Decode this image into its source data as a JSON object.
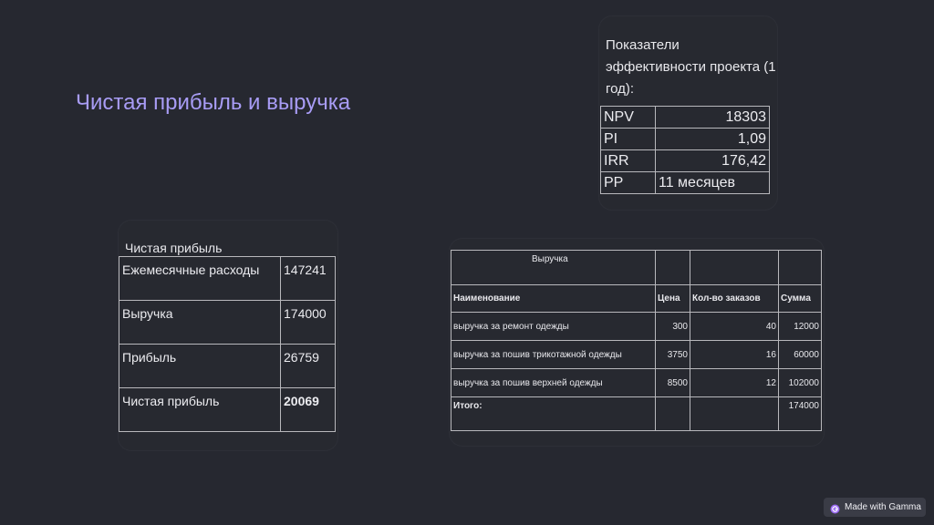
{
  "slide": {
    "title": "Чистая прибыль и выручка"
  },
  "kpi": {
    "heading": "Показатели эффективности проекта (1 год):",
    "rows": [
      {
        "name": "NPV",
        "value": "18303"
      },
      {
        "name": "PI",
        "value": "1,09"
      },
      {
        "name": "IRR",
        "value": "176,42"
      },
      {
        "name": "PP",
        "value": "11 месяцев"
      }
    ]
  },
  "profit": {
    "caption": "Чистая прибыль",
    "rows": [
      {
        "label": "Ежемесячные расходы",
        "value": "147241"
      },
      {
        "label": "Выручка",
        "value": "174000"
      },
      {
        "label": "Прибыль",
        "value": "26759"
      },
      {
        "label": "Чистая прибыль",
        "value": "20069"
      }
    ]
  },
  "revenue": {
    "title": "Выручка",
    "headers": {
      "name": "Наименование",
      "price": "Цена",
      "qty": "Кол-во заказов",
      "sum": "Сумма"
    },
    "rows": [
      {
        "name": "выручка за ремонт одежды",
        "price": "300",
        "qty": "40",
        "sum": "12000"
      },
      {
        "name": "выручка за пошив трикотажной одежды",
        "price": "3750",
        "qty": "16",
        "sum": "60000"
      },
      {
        "name": "выручка за пошив верхней одежды",
        "price": "8500",
        "qty": "12",
        "sum": "102000"
      }
    ],
    "total": {
      "label": "Итого:",
      "sum": "174000"
    }
  },
  "badge": {
    "label": "Made with Gamma",
    "icon": "gamma-logo-icon"
  },
  "colors": {
    "background": "#262830",
    "title_accent": "#a89cf5",
    "table_border": "#b8b8bc"
  }
}
